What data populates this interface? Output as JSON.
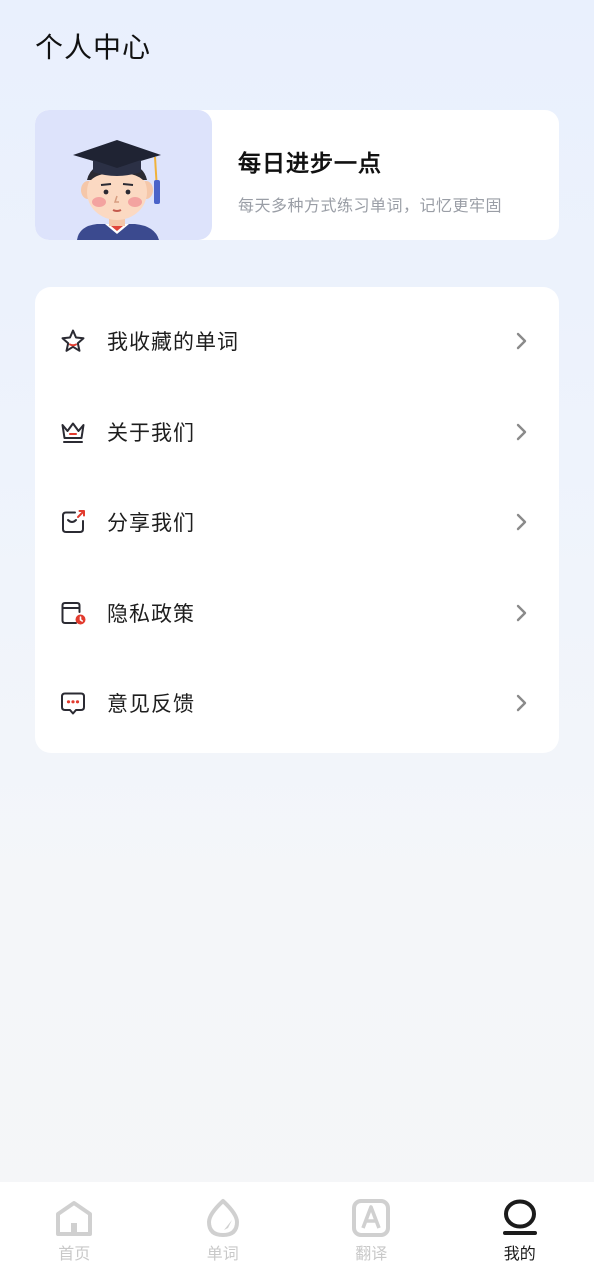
{
  "header": {
    "title": "个人中心"
  },
  "banner": {
    "title": "每日进步一点",
    "subtitle": "每天多种方式练习单词，记忆更牢固"
  },
  "menu": {
    "items": [
      {
        "label": "我收藏的单词",
        "icon": "star-icon"
      },
      {
        "label": "关于我们",
        "icon": "crown-icon"
      },
      {
        "label": "分享我们",
        "icon": "share-icon"
      },
      {
        "label": "隐私政策",
        "icon": "privacy-folder-icon"
      },
      {
        "label": "意见反馈",
        "icon": "feedback-chat-icon"
      }
    ]
  },
  "tabbar": {
    "tabs": [
      {
        "label": "首页",
        "icon": "home-icon",
        "active": false
      },
      {
        "label": "单词",
        "icon": "word-drop-icon",
        "active": false
      },
      {
        "label": "翻译",
        "icon": "translate-a-icon",
        "active": false
      },
      {
        "label": "我的",
        "icon": "profile-icon",
        "active": true
      }
    ]
  },
  "colors": {
    "accent_red": "#e23b2e",
    "icon_dark": "#2b2b33",
    "tab_inactive": "#cfcfcf",
    "tab_active": "#1b1b1b"
  }
}
